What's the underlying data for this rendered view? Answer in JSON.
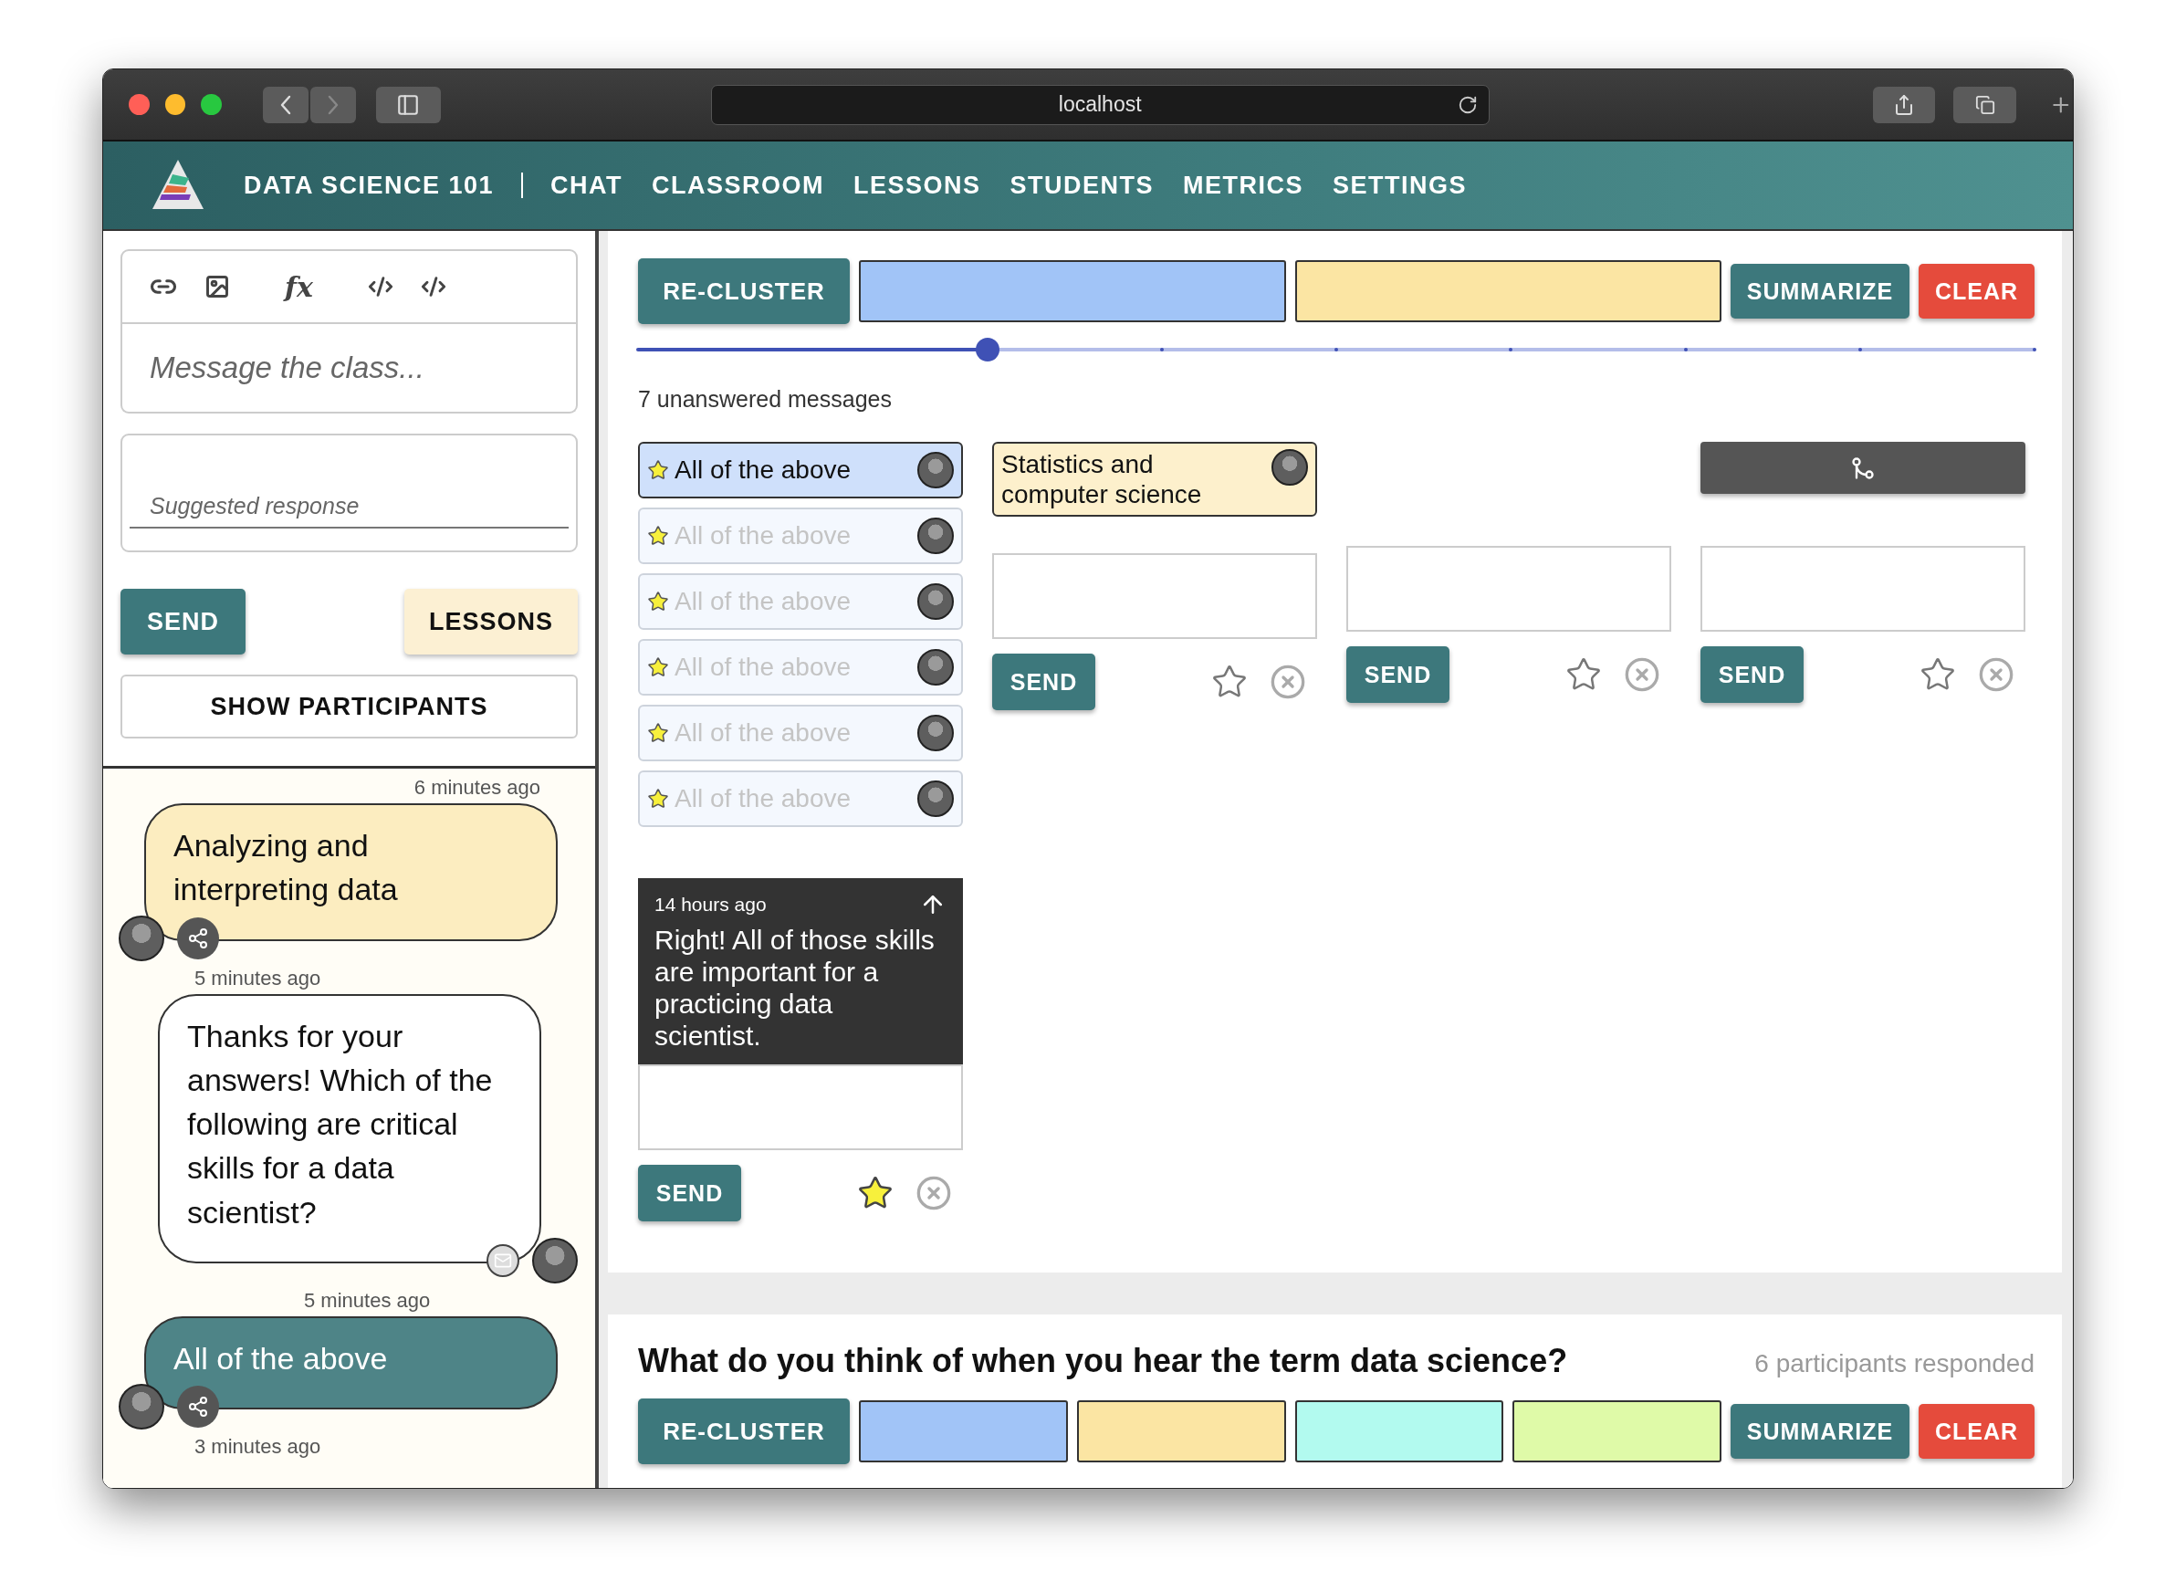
{
  "browser": {
    "url": "localhost"
  },
  "nav": {
    "brand": "DATA SCIENCE 101",
    "items": [
      "CHAT",
      "CLASSROOM",
      "LESSONS",
      "STUDENTS",
      "METRICS",
      "SETTINGS"
    ]
  },
  "composer": {
    "formula_label": "fx",
    "placeholder": "Message the class...",
    "suggested_placeholder": "Suggested response",
    "send": "SEND",
    "lessons": "LESSONS",
    "participants": "SHOW PARTICIPANTS"
  },
  "chat": [
    {
      "time": "6 minutes ago",
      "text": "Analyzing and interpreting data",
      "kind": "student"
    },
    {
      "time": "5 minutes ago",
      "text": "Thanks for your answers! Which of the following are critical skills for a data scientist?",
      "kind": "teacher"
    },
    {
      "time": "5 minutes ago",
      "text": "All of the above",
      "kind": "featured"
    }
  ],
  "chat_trailing_time": "3 minutes ago",
  "questions": [
    {
      "recluster": "RE-CLUSTER",
      "clusters": [
        {
          "color": "#a1c4f7"
        },
        {
          "color": "#fbe5a3"
        }
      ],
      "summarize": "SUMMARIZE",
      "clear": "CLEAR",
      "slider": {
        "level": 0.25
      },
      "unanswered": "7 unanswered messages",
      "groups": [
        {
          "kind": "list",
          "answers": [
            {
              "text": "All of the above",
              "selected": true
            },
            {
              "text": "All of the above",
              "selected": false
            },
            {
              "text": "All of the above",
              "selected": false
            },
            {
              "text": "All of the above",
              "selected": false
            },
            {
              "text": "All of the above",
              "selected": false
            },
            {
              "text": "All of the above",
              "selected": false
            }
          ],
          "reply": {
            "time": "14 hours ago",
            "text": "Right! All of those skills are important for a practicing data scientist."
          },
          "send": "SEND",
          "starred": true
        },
        {
          "kind": "single",
          "answers": [
            {
              "text": "Statistics and computer science"
            }
          ],
          "send": "SEND",
          "starred": false
        },
        {
          "kind": "empty",
          "send": "SEND",
          "starred": false
        },
        {
          "kind": "merge",
          "send": "SEND",
          "starred": false
        }
      ]
    },
    {
      "title": "What do you think of when you hear the term data science?",
      "responded": "6 participants responded",
      "recluster": "RE-CLUSTER",
      "clusters": [
        {
          "color": "#a1c4f7"
        },
        {
          "color": "#fbe5a3"
        },
        {
          "color": "#b2faef"
        },
        {
          "color": "#dffaa8"
        }
      ],
      "summarize": "SUMMARIZE",
      "clear": "CLEAR"
    }
  ]
}
